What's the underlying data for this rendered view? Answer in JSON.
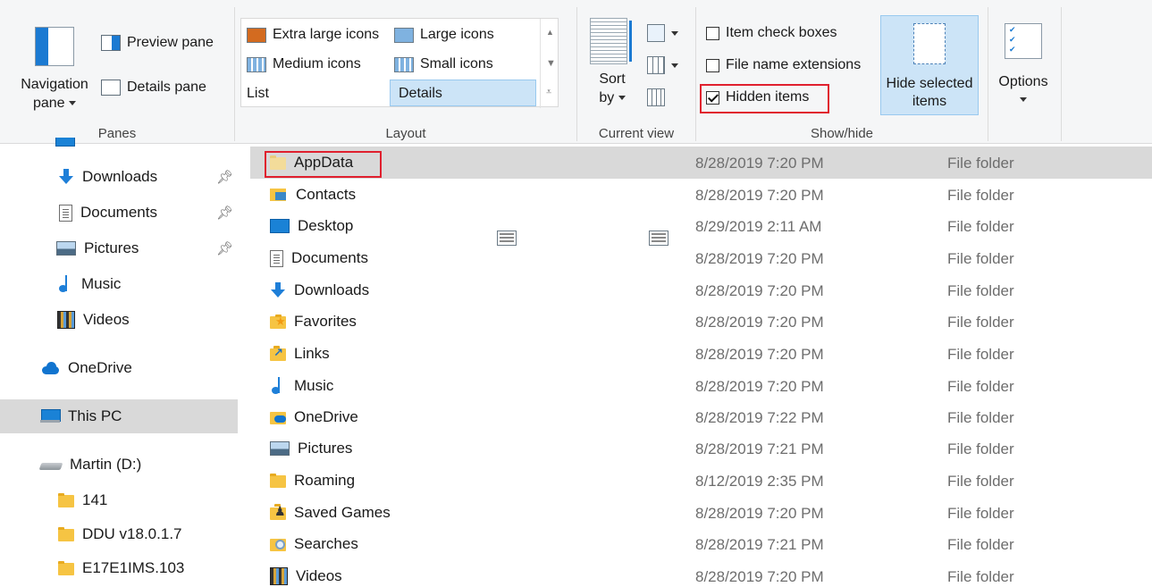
{
  "ribbon": {
    "panes": {
      "navigation_pane": "Navigation",
      "navigation_pane_line2": "pane",
      "preview_pane": "Preview pane",
      "details_pane": "Details pane",
      "label": "Panes"
    },
    "layout": {
      "extra_large_icons": "Extra large icons",
      "large_icons": "Large icons",
      "medium_icons": "Medium icons",
      "small_icons": "Small icons",
      "list": "List",
      "details": "Details",
      "label": "Layout"
    },
    "current_view": {
      "sort_by": "Sort",
      "sort_by_line2": "by",
      "label": "Current view"
    },
    "show_hide": {
      "item_check_boxes": "Item check boxes",
      "file_name_extensions": "File name extensions",
      "hidden_items": "Hidden items",
      "hide_selected": "Hide selected",
      "hide_selected_line2": "items",
      "label": "Show/hide"
    },
    "options": "Options"
  },
  "nav": {
    "items": [
      {
        "label": "Downloads"
      },
      {
        "label": "Documents"
      },
      {
        "label": "Pictures"
      },
      {
        "label": "Music"
      },
      {
        "label": "Videos"
      },
      {
        "label": "OneDrive"
      },
      {
        "label": "This PC"
      },
      {
        "label": "Martin (D:)"
      },
      {
        "label": "141"
      },
      {
        "label": "DDU v18.0.1.7"
      },
      {
        "label": "E17E1IMS.103"
      }
    ]
  },
  "files": [
    {
      "name": "AppData",
      "date": "8/28/2019 7:20 PM",
      "type": "File folder"
    },
    {
      "name": "Contacts",
      "date": "8/28/2019 7:20 PM",
      "type": "File folder"
    },
    {
      "name": "Desktop",
      "date": "8/29/2019 2:11 AM",
      "type": "File folder"
    },
    {
      "name": "Documents",
      "date": "8/28/2019 7:20 PM",
      "type": "File folder"
    },
    {
      "name": "Downloads",
      "date": "8/28/2019 7:20 PM",
      "type": "File folder"
    },
    {
      "name": "Favorites",
      "date": "8/28/2019 7:20 PM",
      "type": "File folder"
    },
    {
      "name": "Links",
      "date": "8/28/2019 7:20 PM",
      "type": "File folder"
    },
    {
      "name": "Music",
      "date": "8/28/2019 7:20 PM",
      "type": "File folder"
    },
    {
      "name": "OneDrive",
      "date": "8/28/2019 7:22 PM",
      "type": "File folder"
    },
    {
      "name": "Pictures",
      "date": "8/28/2019 7:21 PM",
      "type": "File folder"
    },
    {
      "name": "Roaming",
      "date": "8/12/2019 2:35 PM",
      "type": "File folder"
    },
    {
      "name": "Saved Games",
      "date": "8/28/2019 7:20 PM",
      "type": "File folder"
    },
    {
      "name": "Searches",
      "date": "8/28/2019 7:21 PM",
      "type": "File folder"
    },
    {
      "name": "Videos",
      "date": "8/28/2019 7:20 PM",
      "type": "File folder"
    }
  ],
  "colors": {
    "selection": "#cce4f7",
    "row_selected": "#d9d9d9",
    "highlight_box": "#e0202e",
    "accent": "#1b7ad2"
  }
}
